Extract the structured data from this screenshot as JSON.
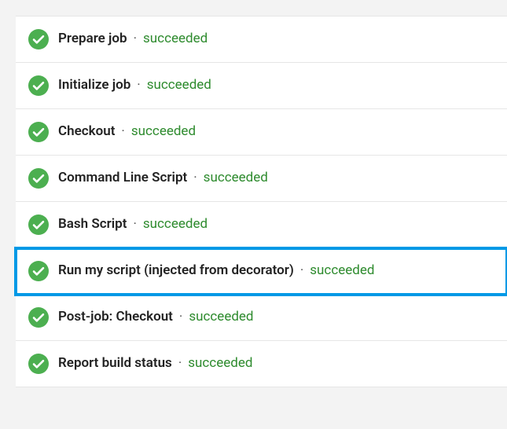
{
  "separator": "·",
  "status_color_success": "#2e8b2e",
  "icon_color_success": "#4caf50",
  "highlight_color": "#0099e6",
  "steps": [
    {
      "name": "Prepare job",
      "status": "succeeded",
      "highlighted": false
    },
    {
      "name": "Initialize job",
      "status": "succeeded",
      "highlighted": false
    },
    {
      "name": "Checkout",
      "status": "succeeded",
      "highlighted": false
    },
    {
      "name": "Command Line Script",
      "status": "succeeded",
      "highlighted": false
    },
    {
      "name": "Bash Script",
      "status": "succeeded",
      "highlighted": false
    },
    {
      "name": "Run my script (injected from decorator)",
      "status": "succeeded",
      "highlighted": true
    },
    {
      "name": "Post-job: Checkout",
      "status": "succeeded",
      "highlighted": false
    },
    {
      "name": "Report build status",
      "status": "succeeded",
      "highlighted": false
    }
  ]
}
